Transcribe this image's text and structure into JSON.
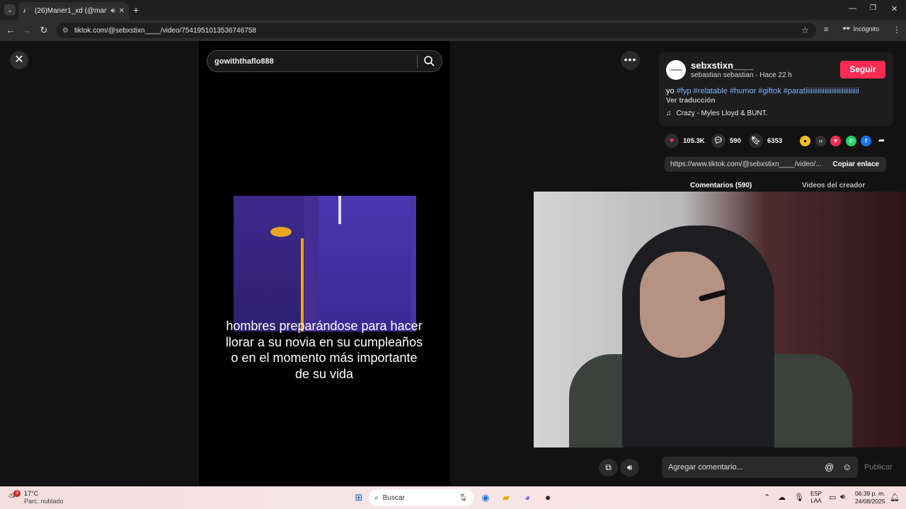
{
  "browser": {
    "tab_title": "(26)Maner1_xd (@maner1_...",
    "url": "tiktok.com/@sebxstixn____/video/7541951013536746758",
    "incognito_label": "Incógnito"
  },
  "video": {
    "search_value": "gowiththaflo888",
    "caption": "hombres preparándose para hacer llorar a su novia en su cumpleaños o en el momento más importante de su vida"
  },
  "info": {
    "username": "sebxstixn____",
    "subline": "sebastian sebastian · Hace 22 h",
    "avatar_text": "Sebastian",
    "follow_label": "Seguir",
    "desc_prefix": "yo ",
    "hashtags": [
      "#fyp",
      "#relatable",
      "#humor",
      "#giftok",
      "#paratiiiiiiiiiiiiiiiiiiiiiiiiiiiiiii"
    ],
    "translate": "Ver traducción",
    "music": "Crazy - Myles Lloyd & BUNT."
  },
  "stats": {
    "likes": "105.3K",
    "comments": "590",
    "saves": "6353"
  },
  "link": {
    "url": "https://www.tiktok.com/@sebxstixn____/video/...",
    "copy_label": "Copiar enlace"
  },
  "tabs": {
    "comments": "Comentarios (590)",
    "creator": "Videos del creador"
  },
  "comment": {
    "placeholder": "Agregar comentario...",
    "publish": "Publicar"
  },
  "taskbar": {
    "weather_temp": "17°C",
    "weather_desc": "Parc. nublado",
    "weather_badge": "3",
    "search_placeholder": "Buscar",
    "lang1": "ESP",
    "lang2": "LAA",
    "time": "06:39 p. m.",
    "date": "24/08/2025"
  },
  "colors": {
    "accent": "#fe2c55",
    "hashtag": "#7fb4ff"
  }
}
